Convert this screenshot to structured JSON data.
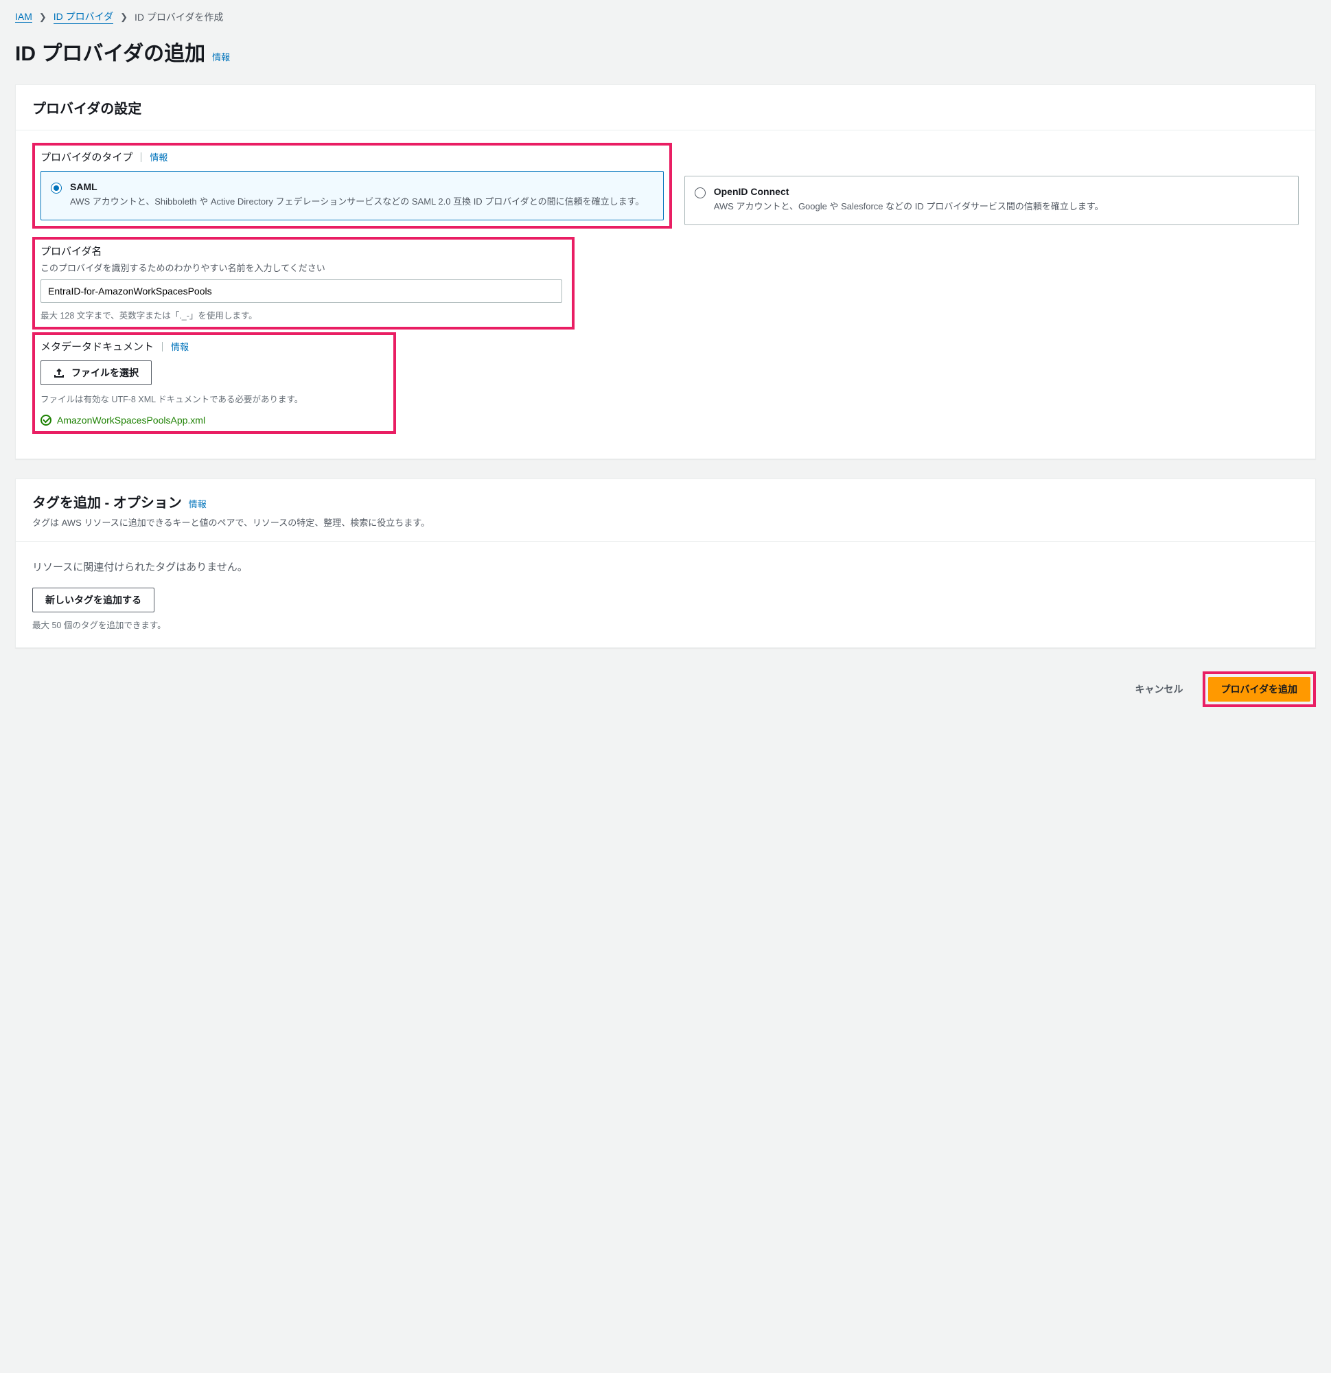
{
  "breadcrumb": {
    "iam": "IAM",
    "providers": "ID プロバイダ",
    "create": "ID プロバイダを作成"
  },
  "page": {
    "title": "ID プロバイダの追加",
    "info": "情報"
  },
  "config_panel": {
    "title": "プロバイダの設定"
  },
  "provider_type": {
    "label": "プロバイダのタイプ",
    "info": "情報",
    "saml": {
      "title": "SAML",
      "desc": "AWS アカウントと、Shibboleth や Active Directory フェデレーションサービスなどの SAML 2.0 互換 ID プロバイダとの間に信頼を確立します。"
    },
    "openid": {
      "title": "OpenID Connect",
      "desc": "AWS アカウントと、Google や Salesforce などの ID プロバイダサービス間の信頼を確立します。"
    }
  },
  "provider_name": {
    "label": "プロバイダ名",
    "desc": "このプロバイダを識別するためのわかりやすい名前を入力してください",
    "value": "EntraID-for-AmazonWorkSpacesPools",
    "constraint": "最大 128 文字まで、英数字または「._-」を使用します。"
  },
  "metadata": {
    "label": "メタデータドキュメント",
    "info": "情報",
    "choose": "ファイルを選択",
    "file_hint": "ファイルは有効な UTF-8 XML ドキュメントである必要があります。",
    "uploaded": "AmazonWorkSpacesPoolsApp.xml"
  },
  "tags_panel": {
    "title": "タグを追加 - オプション",
    "info": "情報",
    "desc": "タグは AWS リソースに追加できるキーと値のペアで、リソースの特定、整理、検索に役立ちます。",
    "empty": "リソースに関連付けられたタグはありません。",
    "add_button": "新しいタグを追加する",
    "constraint": "最大 50 個のタグを追加できます。"
  },
  "actions": {
    "cancel": "キャンセル",
    "submit": "プロバイダを追加"
  }
}
